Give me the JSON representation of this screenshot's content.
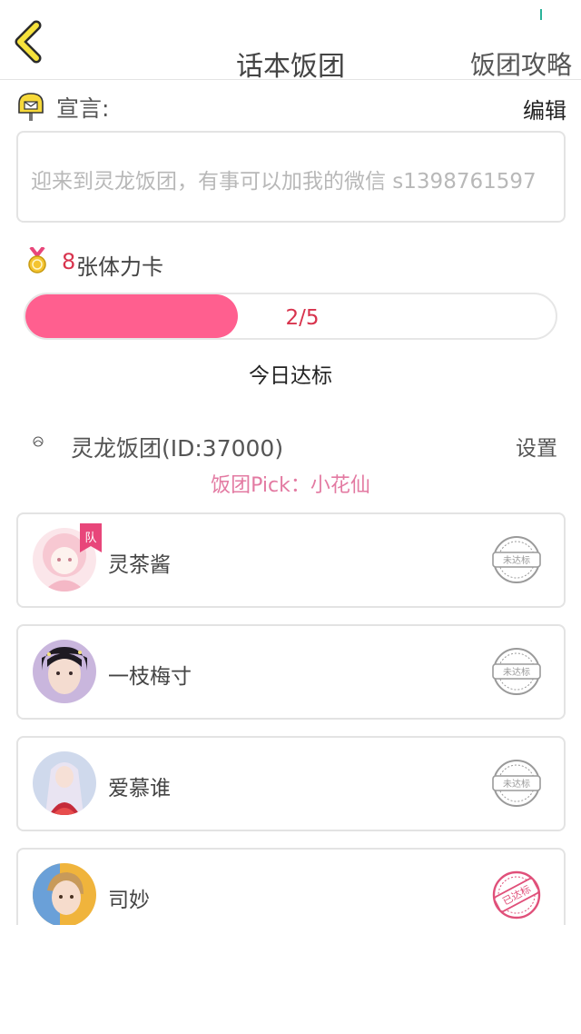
{
  "header": {
    "title": "话本饭团",
    "action_label": "饭团攻略"
  },
  "declaration": {
    "label": "宣言:",
    "edit_label": "编辑",
    "text": "迎来到灵龙饭团，有事可以加我的微信 s1398761597"
  },
  "stamina": {
    "count": "8",
    "label": "张体力卡"
  },
  "progress": {
    "current": 2,
    "total": 5,
    "text": "2/5",
    "fill_color": "#ff5f8f"
  },
  "today_label": "今日达标",
  "group": {
    "name": "灵龙饭团(ID:37000)",
    "settings_label": "设置",
    "pick_text": "饭团Pick：小花仙"
  },
  "members": [
    {
      "name": "灵茶酱",
      "is_leader": true,
      "leader_badge": "队",
      "status": "未达标",
      "reached": false
    },
    {
      "name": "一枝梅寸",
      "is_leader": false,
      "status": "未达标",
      "reached": false
    },
    {
      "name": "爱慕谁",
      "is_leader": false,
      "status": "未达标",
      "reached": false
    },
    {
      "name": "司妙",
      "is_leader": false,
      "status": "已达标",
      "reached": true
    }
  ],
  "colors": {
    "accent_pink": "#ff5f8f",
    "count_red": "#d8334d",
    "pick_pink": "#e37aa2",
    "stamp_gray": "#9a9a9a",
    "stamp_pink": "#e0507a"
  }
}
